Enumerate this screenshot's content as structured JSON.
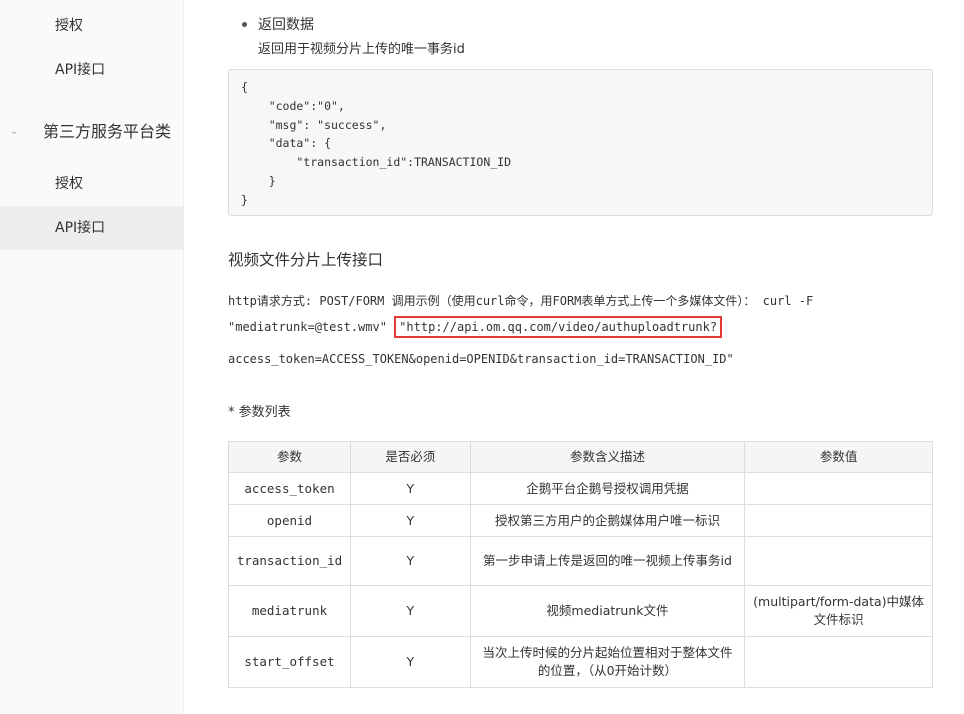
{
  "sidebar": {
    "items": [
      {
        "label": "授权"
      },
      {
        "label": "API接口"
      }
    ],
    "group": {
      "label": "第三方服务平台类"
    },
    "sub_items": [
      {
        "label": "授权"
      },
      {
        "label": "API接口"
      }
    ]
  },
  "main": {
    "bullet_title": "返回数据",
    "bullet_desc": "返回用于视频分片上传的唯一事务id",
    "code": "{\n    \"code\":\"0\",\n    \"msg\": \"success\",\n    \"data\": {\n        \"transaction_id\":TRANSACTION_ID\n    }\n}",
    "heading": "视频文件分片上传接口",
    "line1": "http请求方式: POST/FORM 调用示例（使用curl命令，用FORM表单方式上传一个多媒体文件）： curl -F",
    "line2a": "\"mediatrunk=@test.wmv\" ",
    "line2b": "\"http://api.om.qq.com/video/authuploadtrunk?",
    "line3": "access_token=ACCESS_TOKEN&openid=OPENID&transaction_id=TRANSACTION_ID\"",
    "params_title": "* 参数列表",
    "table": {
      "headers": [
        "参数",
        "是否必须",
        "参数含义描述",
        "参数值"
      ],
      "rows": [
        [
          "access_token",
          "Y",
          "企鹅平台企鹅号授权调用凭据",
          ""
        ],
        [
          "openid",
          "Y",
          "授权第三方用户的企鹅媒体用户唯一标识",
          ""
        ],
        [
          "transaction_id",
          "Y",
          "第一步申请上传是返回的唯一视频上传事务id",
          ""
        ],
        [
          "mediatrunk",
          "Y",
          "视频mediatrunk文件",
          "(multipart/form-data)中媒体文件标识"
        ],
        [
          "start_offset",
          "Y",
          "当次上传时候的分片起始位置相对于整体文件的位置，（从0开始计数）",
          ""
        ]
      ]
    }
  }
}
